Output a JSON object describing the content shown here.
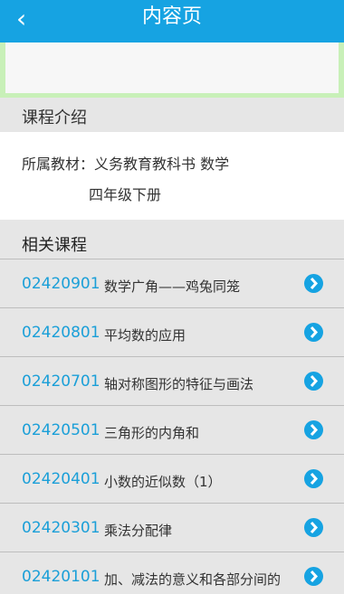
{
  "header": {
    "back_icon": "‹",
    "title": "内容页"
  },
  "intro_section": {
    "heading": "课程介绍",
    "textbook_line1": "所属教材：义务教育教科书 数学",
    "textbook_line2": "四年级下册"
  },
  "related_section": {
    "heading": "相关课程",
    "courses": [
      {
        "code": "02420901",
        "name": "数学广角——鸡兔同笼"
      },
      {
        "code": "02420801",
        "name": "平均数的应用"
      },
      {
        "code": "02420701",
        "name": "轴对称图形的特征与画法"
      },
      {
        "code": "02420501",
        "name": "三角形的内角和"
      },
      {
        "code": "02420401",
        "name": "小数的近似数（1）"
      },
      {
        "code": "02420301",
        "name": "乘法分配律"
      },
      {
        "code": "02420101",
        "name": "加、减法的意义和各部分间的"
      }
    ]
  },
  "colors": {
    "accent": "#16a3e2",
    "code_text": "#1a9fd8",
    "highlight_border": "#c8f0b8"
  },
  "icons": {
    "back": "back-icon",
    "row_arrow": "chevron-right-circle-icon"
  }
}
